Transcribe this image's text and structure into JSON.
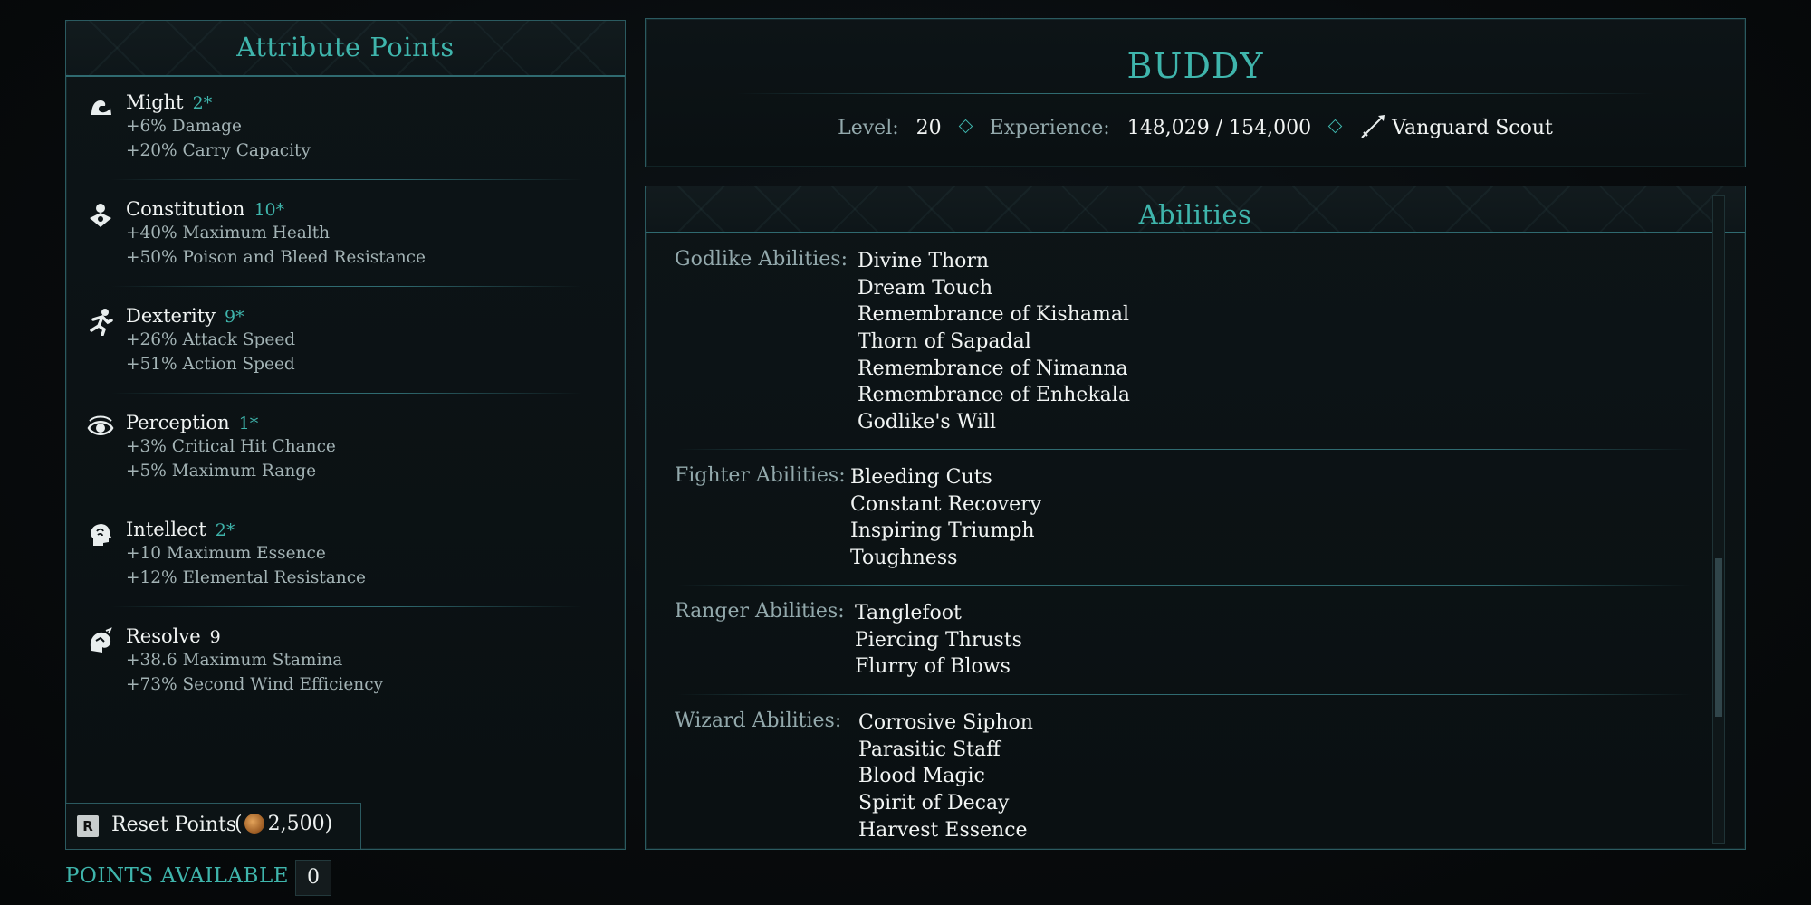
{
  "attributes": {
    "title": "Attribute Points",
    "items": [
      {
        "name": "Might",
        "value": "2*",
        "bonuses": [
          "+6% Damage",
          "+20% Carry Capacity"
        ],
        "icon": "might-icon"
      },
      {
        "name": "Constitution",
        "value": "10*",
        "bonuses": [
          "+40% Maximum Health",
          "+50% Poison and Bleed Resistance"
        ],
        "icon": "constitution-icon"
      },
      {
        "name": "Dexterity",
        "value": "9*",
        "bonuses": [
          "+26% Attack Speed",
          "+51% Action Speed"
        ],
        "icon": "dexterity-icon"
      },
      {
        "name": "Perception",
        "value": "1*",
        "bonuses": [
          "+3% Critical Hit Chance",
          "+5% Maximum Range"
        ],
        "icon": "perception-icon"
      },
      {
        "name": "Intellect",
        "value": "2*",
        "bonuses": [
          "+10 Maximum Essence",
          "+12% Elemental Resistance"
        ],
        "icon": "intellect-icon"
      },
      {
        "name": "Resolve",
        "value": "9",
        "bonuses": [
          "+38.6 Maximum Stamina",
          "+73% Second Wind Efficiency"
        ],
        "icon": "resolve-icon"
      }
    ],
    "reset": {
      "key": "R",
      "label": "Reset Points",
      "cost_open": "(",
      "cost": "2,500",
      "cost_close": ")"
    },
    "points_available_label": "POINTS AVAILABLE",
    "points_available": "0"
  },
  "character": {
    "name": "BUDDY",
    "level_label": "Level:",
    "level": "20",
    "experience_label": "Experience:",
    "experience": "148,029 / 154,000",
    "class": "Vanguard Scout"
  },
  "abilities": {
    "title": "Abilities",
    "groups": [
      {
        "label": "Godlike Abilities:",
        "items": [
          "Divine Thorn",
          "Dream Touch",
          "Remembrance of Kishamal",
          "Thorn of Sapadal",
          "Remembrance of Nimanna",
          "Remembrance of Enhekala",
          "Godlike's Will"
        ]
      },
      {
        "label": "Fighter Abilities:",
        "items": [
          "Bleeding Cuts",
          "Constant Recovery",
          "Inspiring Triumph",
          "Toughness"
        ]
      },
      {
        "label": "Ranger Abilities:",
        "items": [
          "Tanglefoot",
          "Piercing Thrusts",
          "Flurry of Blows"
        ]
      },
      {
        "label": "Wizard Abilities:",
        "items": [
          "Corrosive Siphon",
          "Parasitic Staff",
          "Blood Magic",
          "Spirit of Decay",
          "Harvest Essence"
        ]
      }
    ]
  },
  "colors": {
    "accent": "#3fb5ac",
    "border": "#2b5a60",
    "label": "#93a9ac",
    "text": "#f1f4f3"
  }
}
